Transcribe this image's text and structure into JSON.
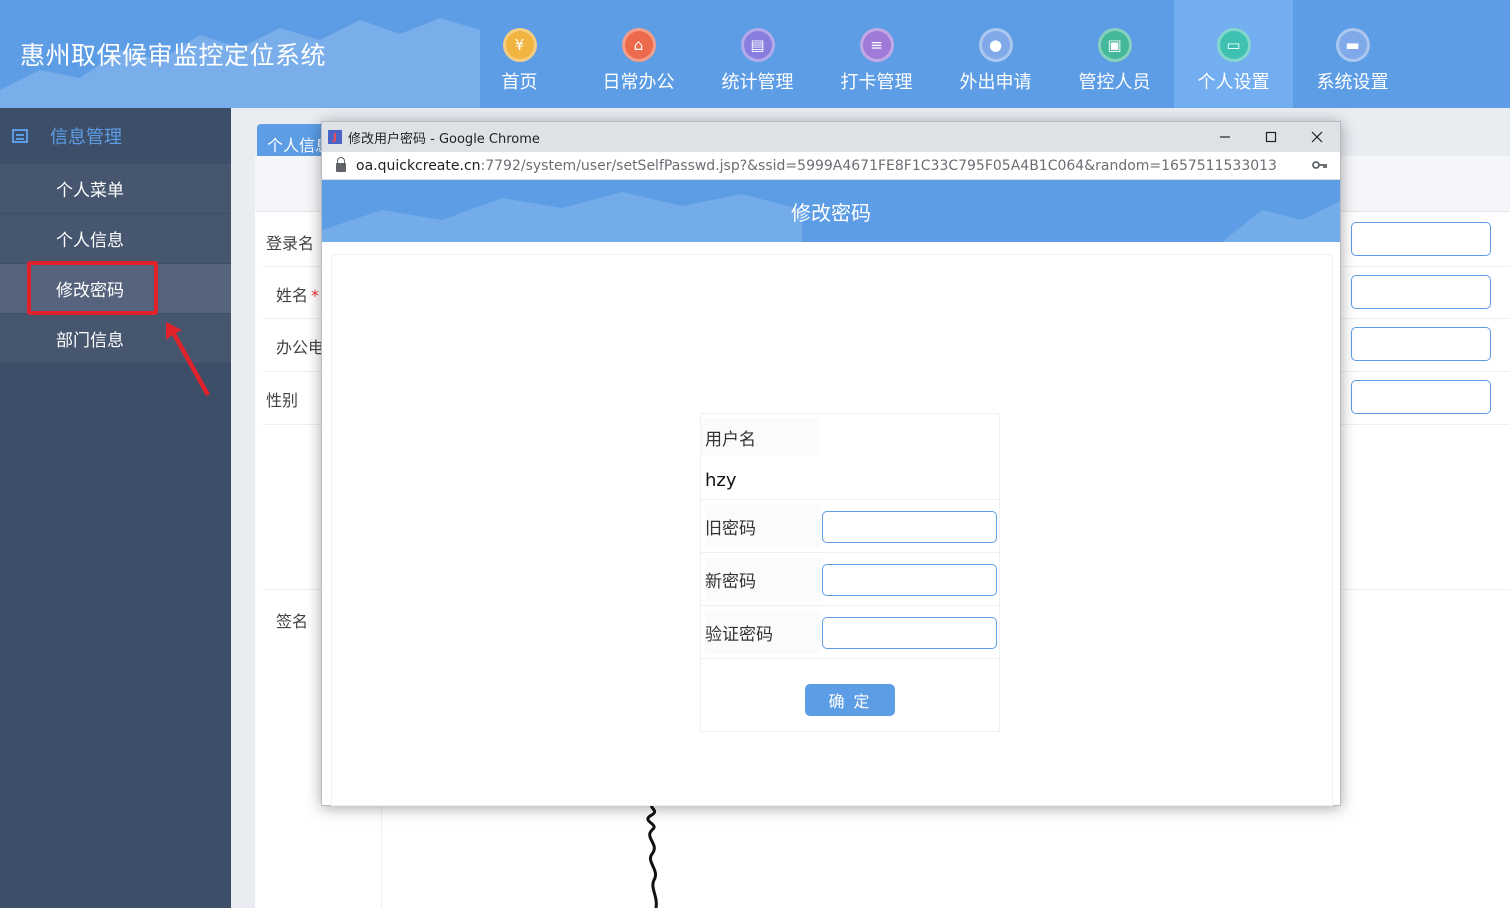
{
  "app": {
    "title": "惠州取保候审监控定位系统"
  },
  "nav": [
    {
      "label": "首页",
      "icon": "yen-icon",
      "color": "#f2b441",
      "glyph": "¥"
    },
    {
      "label": "日常办公",
      "icon": "home-icon",
      "color": "#ee6a4c",
      "glyph": "⌂"
    },
    {
      "label": "统计管理",
      "icon": "briefcase-icon",
      "color": "#8a7de0",
      "glyph": "▤"
    },
    {
      "label": "打卡管理",
      "icon": "document-icon",
      "color": "#a07ad8",
      "glyph": "≡"
    },
    {
      "label": "外出申请",
      "icon": "user-icon",
      "color": "#7fa9e8",
      "glyph": "●"
    },
    {
      "label": "管控人员",
      "icon": "presentation-icon",
      "color": "#44b89b",
      "glyph": "▣"
    },
    {
      "label": "个人设置",
      "icon": "id-card-icon",
      "color": "#3fc0b0",
      "glyph": "▭"
    },
    {
      "label": "系统设置",
      "icon": "car-icon",
      "color": "#7fa9e8",
      "glyph": "▬"
    }
  ],
  "sidebar": {
    "header": "信息管理",
    "items": [
      "个人菜单",
      "个人信息",
      "修改密码",
      "部门信息"
    ]
  },
  "background_form": {
    "tab": "个人信息",
    "labels": {
      "login": "登录名",
      "name": "姓名",
      "required_mark": "*",
      "phone": "办公电",
      "gender": "性别",
      "signature": "签名"
    }
  },
  "popup": {
    "window_title": "修改用户密码 - Google Chrome",
    "url_host": "oa.quickcreate.cn",
    "url_path": ":7792/system/user/setSelfPasswd.jsp?&ssid=5999A4671FE8F1C33C795F05A4B1C064&random=1657511533013",
    "header": "修改密码",
    "form": {
      "username_label": "用户名",
      "username_value": "hzy",
      "old_password_label": "旧密码",
      "new_password_label": "新密码",
      "confirm_password_label": "验证密码",
      "submit": "确 定"
    }
  }
}
